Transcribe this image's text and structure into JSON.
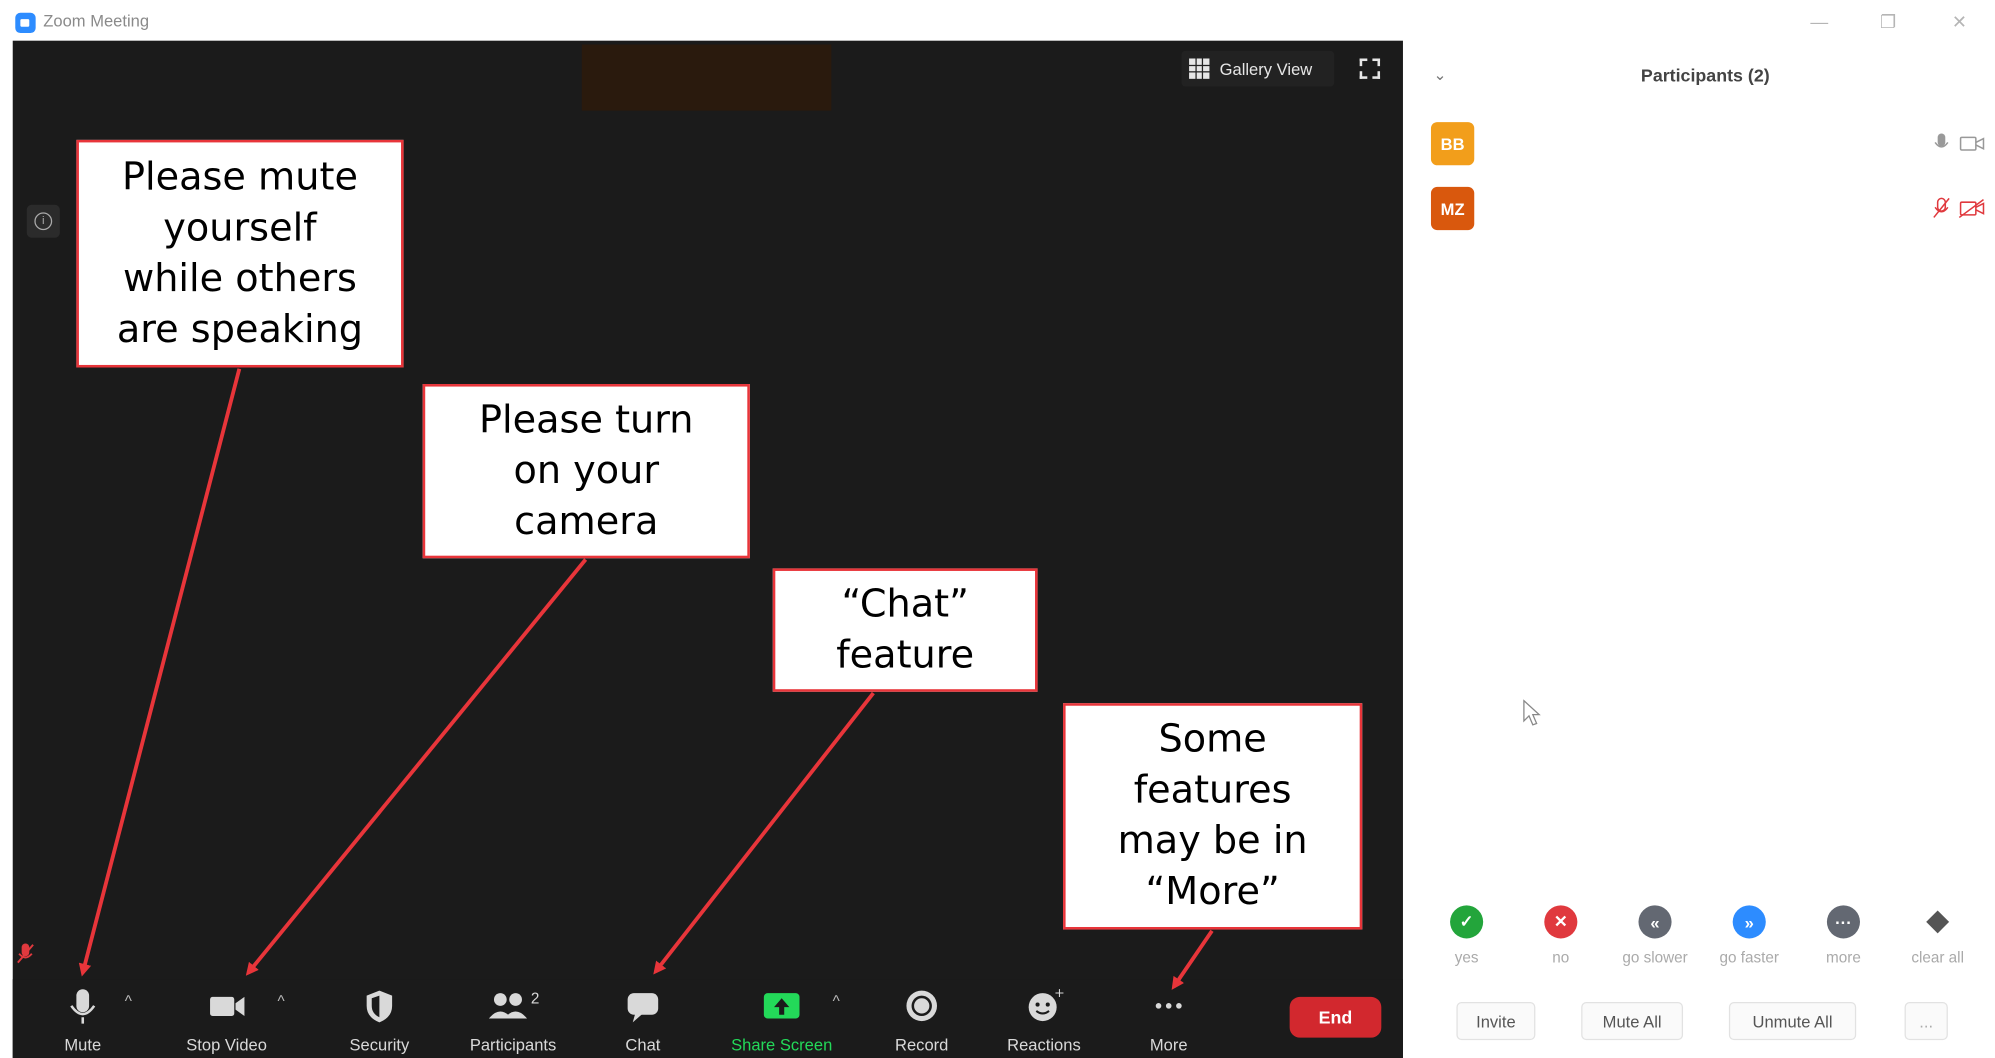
{
  "window": {
    "title": "Zoom Meeting",
    "minimize": "—",
    "restore": "❐",
    "close": "✕"
  },
  "meeting": {
    "gallery_view_label": "Gallery View"
  },
  "toolbar": {
    "mute": "Mute",
    "stop_video": "Stop Video",
    "security": "Security",
    "participants": "Participants",
    "participants_count": "2",
    "chat": "Chat",
    "share_screen": "Share Screen",
    "record": "Record",
    "reactions": "Reactions",
    "more": "More",
    "end": "End"
  },
  "panel": {
    "title": "Participants (2)",
    "participants": [
      {
        "initials": "BB",
        "color": "#f29e1b",
        "mic": "on",
        "video": "off"
      },
      {
        "initials": "MZ",
        "color": "#d9580d",
        "mic": "muted",
        "video": "muted"
      }
    ],
    "feedback": [
      {
        "label": "yes",
        "icon": "check-icon",
        "color": "#23a53b"
      },
      {
        "label": "no",
        "icon": "x-icon",
        "color": "#e0393e"
      },
      {
        "label": "go slower",
        "icon": "rewind-icon",
        "color": "#636872"
      },
      {
        "label": "go faster",
        "icon": "fast-forward-icon",
        "color": "#2d8cff"
      },
      {
        "label": "more",
        "icon": "dots-icon",
        "color": "#636872"
      },
      {
        "label": "clear all",
        "icon": "eraser-icon",
        "color": "#555"
      }
    ],
    "buttons": {
      "invite": "Invite",
      "mute_all": "Mute All",
      "unmute_all": "Unmute All",
      "more": "..."
    }
  },
  "annotations": {
    "mute": [
      "Please mute",
      "yourself",
      "while others",
      "are speaking"
    ],
    "camera": [
      "Please turn",
      "on your",
      "camera"
    ],
    "chat": [
      "“Chat”",
      "feature"
    ],
    "more": [
      "Some",
      "features",
      "may be in",
      "“More”"
    ]
  },
  "colors": {
    "accent": "#2d8cff",
    "annotation_border": "#e8353a",
    "end": "#d2282e",
    "share_screen": "#23d959"
  }
}
